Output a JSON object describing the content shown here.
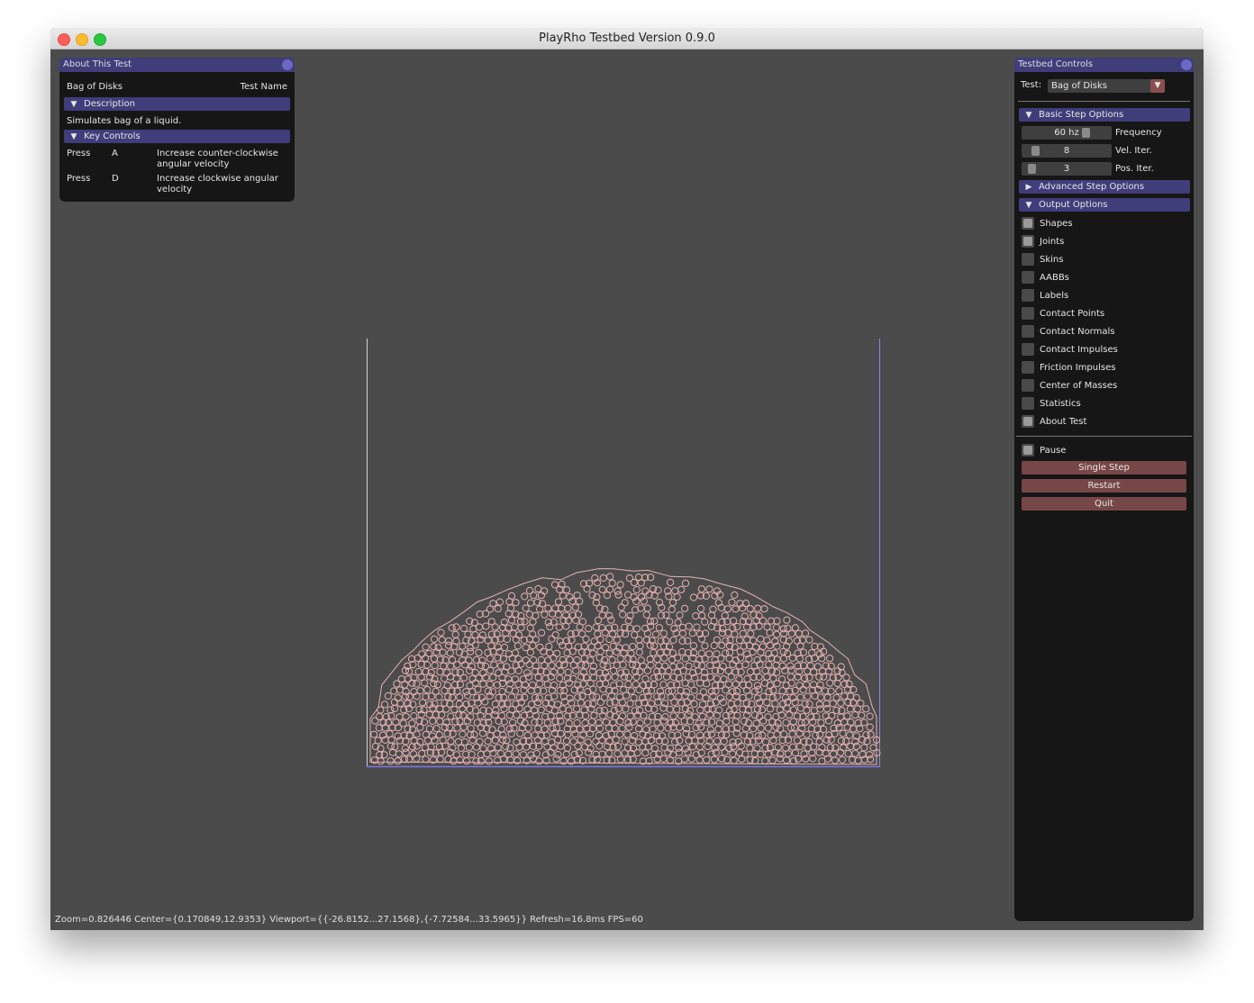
{
  "window": {
    "title": "PlayRho Testbed Version 0.9.0"
  },
  "about": {
    "title": "About This Test",
    "test_name_value": "Bag of Disks",
    "test_name_label": "Test Name",
    "description_header": "Description",
    "description": "Simulates bag of a liquid.",
    "key_controls_header": "Key Controls",
    "keys": [
      {
        "action": "Press",
        "key": "A",
        "desc1": "Increase counter-clockwise",
        "desc2": "angular velocity"
      },
      {
        "action": "Press",
        "key": "D",
        "desc1": "Increase clockwise angular",
        "desc2": "velocity"
      }
    ]
  },
  "controls": {
    "title": "Testbed Controls",
    "test_label": "Test:",
    "test_value": "Bag of Disks",
    "basic_header": "Basic Step Options",
    "sliders": [
      {
        "value": "60 hz",
        "label": "Frequency",
        "fraction": 0.72
      },
      {
        "value": "8",
        "label": "Vel. Iter.",
        "fraction": 0.08
      },
      {
        "value": "3",
        "label": "Pos. Iter.",
        "fraction": 0.03
      }
    ],
    "advanced_header": "Advanced Step Options",
    "output_header": "Output Options",
    "outputs": [
      {
        "label": "Shapes",
        "checked": true
      },
      {
        "label": "Joints",
        "checked": true
      },
      {
        "label": "Skins",
        "checked": false
      },
      {
        "label": "AABBs",
        "checked": false
      },
      {
        "label": "Labels",
        "checked": false
      },
      {
        "label": "Contact Points",
        "checked": false
      },
      {
        "label": "Contact Normals",
        "checked": false
      },
      {
        "label": "Contact Impulses",
        "checked": false
      },
      {
        "label": "Friction Impulses",
        "checked": false
      },
      {
        "label": "Center of Masses",
        "checked": false
      },
      {
        "label": "Statistics",
        "checked": false
      },
      {
        "label": "About Test",
        "checked": true
      }
    ],
    "pause_label": "Pause",
    "pause_checked": true,
    "single_step": "Single Step",
    "restart": "Restart",
    "quit": "Quit"
  },
  "status": "Zoom=0.826446 Center={0.170849,12.9353} Viewport={{-26.8152...27.1568},{-7.72584...33.5965}} Refresh=16.8ms FPS=60",
  "colors": {
    "disk": "#e8b2b2",
    "header": "#3f3d7a",
    "button": "#774646",
    "container_edge": "#7c78e0"
  }
}
